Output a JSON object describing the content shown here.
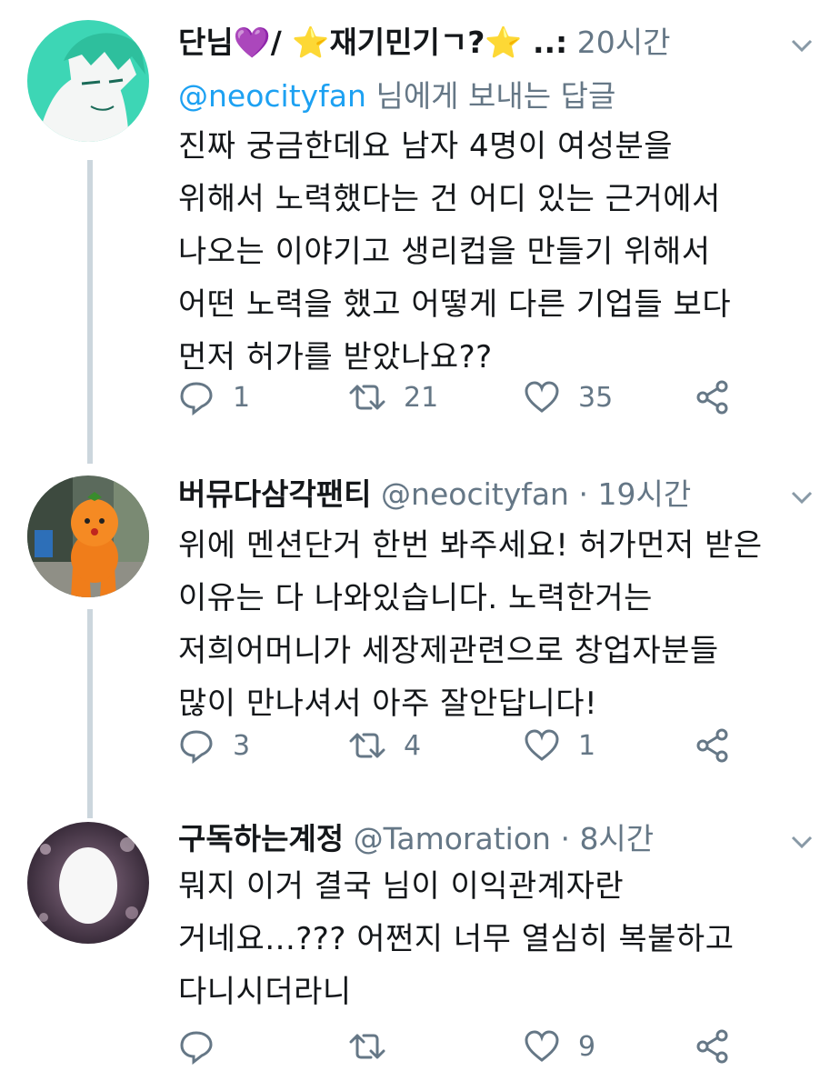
{
  "tweets": [
    {
      "display_name": "단님💜/ ⭐재기민기ㄱ?⭐ ..:",
      "time": "20시간",
      "reply_to_mention": "@neocityfan",
      "reply_to_suffix": "님에게 보내는 답글",
      "text_lines": [
        "진짜 궁금한데요 남자 4명이 여성분을",
        "위해서 노력했다는 건 어디 있는 근거에서",
        "나오는 이야기고 생리컵을 만들기 위해서",
        "어떤 노력을 했고 어떻게 다른 기업들 보다",
        "먼저 허가를 받았나요??"
      ],
      "replies": "1",
      "retweets": "21",
      "likes": "35"
    },
    {
      "display_name": "버뮤다삼각팬티",
      "handle": "@neocityfan",
      "separator": "·",
      "time": "19시간",
      "text_lines": [
        "위에 멘션단거 한번 봐주세요! 허가먼저 받은",
        "이유는 다 나와있습니다. 노력한거는",
        "저희어머니가 세장제관련으로 창업자분들",
        "많이 만나셔서 아주 잘안답니다!"
      ],
      "replies": "3",
      "retweets": "4",
      "likes": "1"
    },
    {
      "display_name": "구독하는계정",
      "handle": "@Tamoration",
      "separator": "·",
      "time": "8시간",
      "text_lines": [
        "뭐지 이거 결국 님이 이익관계자란",
        "거네요...??? 어쩐지 너무 열심히 복붙하고",
        "다니시더라니"
      ],
      "likes": "9"
    }
  ],
  "colors": {
    "thread_line": "#ccd6dd",
    "mention": "#1da1f2",
    "secondary_text": "#657786"
  },
  "icons": [
    "reply-icon",
    "retweet-icon",
    "like-icon",
    "share-icon",
    "chevron-down-icon"
  ]
}
